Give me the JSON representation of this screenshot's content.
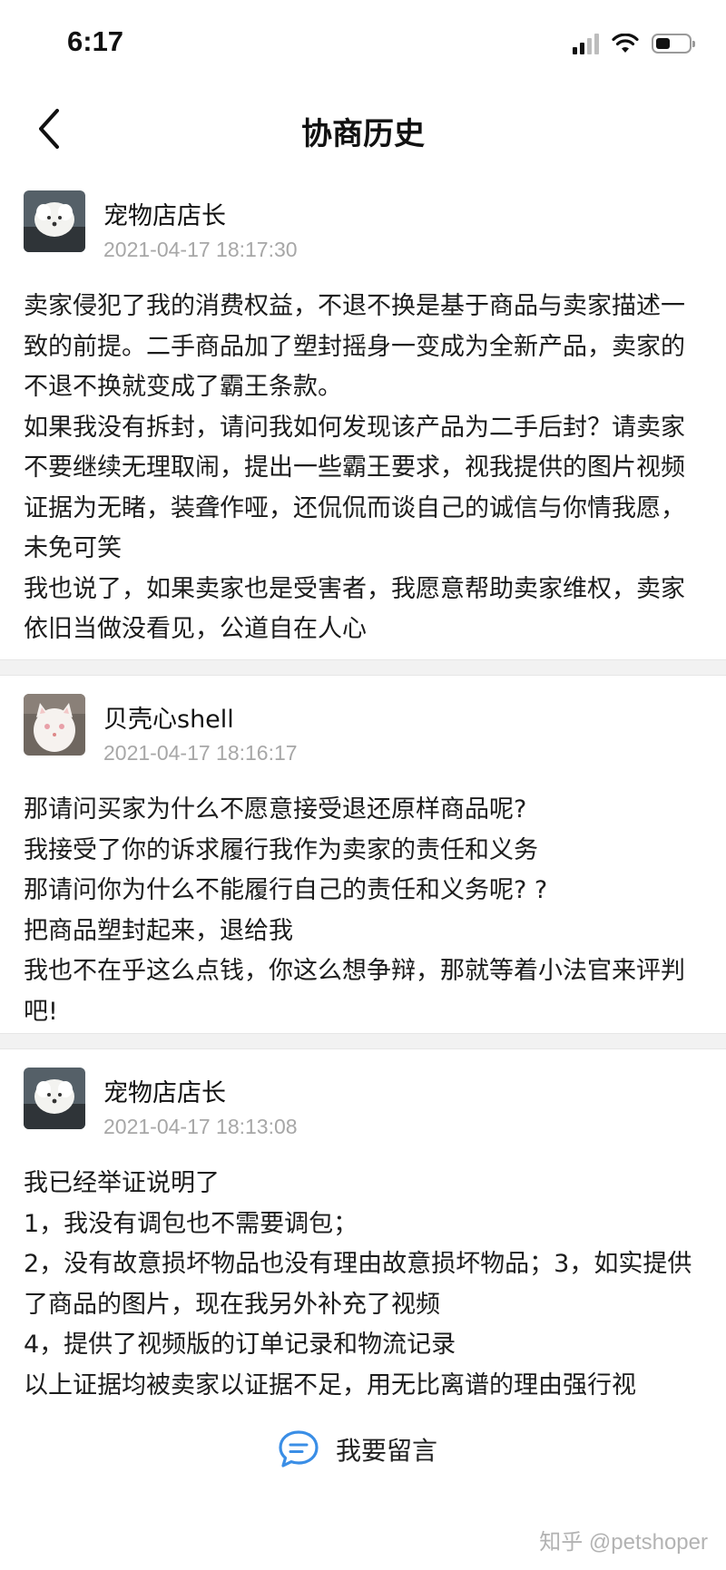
{
  "status_bar": {
    "time": "6:17"
  },
  "header": {
    "title": "协商历史",
    "back_icon": "chevron-left-icon"
  },
  "messages": [
    {
      "author": "宠物店店长",
      "time": "2021-04-17 18:17:30",
      "paragraphs": [
        "卖家侵犯了我的消费权益，不退不换是基于商品与卖家描述一致的前提。二手商品加了塑封摇身一变成为全新产品，卖家的不退不换就变成了霸王条款。",
        "如果我没有拆封，请问我如何发现该产品为二手后封？请卖家不要继续无理取闹，提出一些霸王要求，视我提供的图片视频证据为无睹，装聋作哑，还侃侃而谈自己的诚信与你情我愿，未免可笑",
        "我也说了，如果卖家也是受害者，我愿意帮助卖家维权，卖家依旧当做没看见，公道自在人心"
      ]
    },
    {
      "author": "贝壳心shell",
      "time": "2021-04-17 18:16:17",
      "paragraphs": [
        "那请问买家为什么不愿意接受退还原样商品呢?",
        "我接受了你的诉求履行我作为卖家的责任和义务",
        "那请问你为什么不能履行自己的责任和义务呢? ?",
        "把商品塑封起来，退给我",
        "我也不在乎这么点钱，你这么想争辩，那就等着小法官来评判吧!"
      ]
    },
    {
      "author": "宠物店店长",
      "time": "2021-04-17 18:13:08",
      "paragraphs": [
        "我已经举证说明了",
        "1，我没有调包也不需要调包；",
        "2，没有故意损坏物品也没有理由故意损坏物品；3，如实提供了商品的图片，现在我另外补充了视频",
        "4，提供了视频版的订单记录和物流记录",
        "以上证据均被卖家以证据不足，用无比离谱的理由强行视"
      ]
    }
  ],
  "bottom_bar": {
    "leave_message_label": "我要留言",
    "icon": "chat-bubble-icon"
  },
  "watermark": "知乎 @petshoper",
  "colors": {
    "text": "#1c1c1c",
    "timestamp": "#a7a7a7",
    "accent": "#3a8ee6",
    "divider": "#f2f2f2"
  }
}
